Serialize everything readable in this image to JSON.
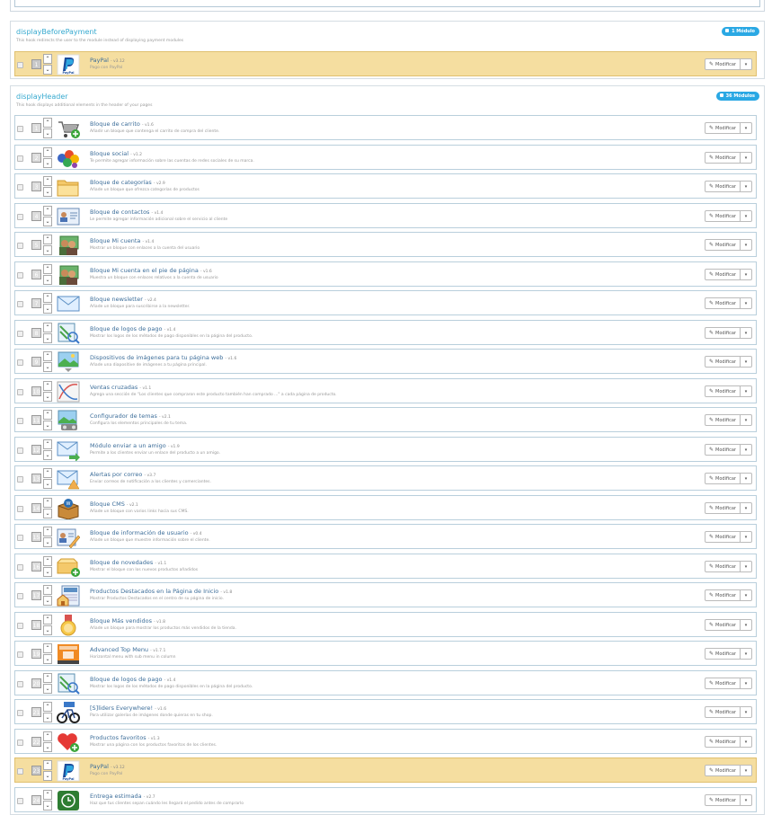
{
  "hooks": [
    {
      "name": "displayBeforePayment",
      "description": "This hook redirects the user to the module instead of displaying payment modules",
      "badge": "1 Módulo",
      "modules": [
        {
          "pos": "1",
          "name": "PayPal",
          "version": "- v3.12",
          "desc": "Pago con PayPal",
          "icon": "paypal-logo-icon",
          "highlight": true
        }
      ]
    },
    {
      "name": "displayHeader",
      "description": "This hook displays additional elements in the header of your pages",
      "badge": "36 Módulos",
      "modules": [
        {
          "pos": "1",
          "name": "Bloque de carrito",
          "version": "- v1.6",
          "desc": "Añadir un bloque que contenga el carrito de compra del cliente.",
          "icon": "shopping-cart-icon"
        },
        {
          "pos": "2",
          "name": "Bloque social",
          "version": "- v1.2",
          "desc": "Te permite agregar información sobre las cuentas de redes sociales de su marca.",
          "icon": "social-people-icon"
        },
        {
          "pos": "3",
          "name": "Bloque de categorías",
          "version": "- v2.9",
          "desc": "Añade un bloque que ofrezca categorías de productos",
          "icon": "folder-icon"
        },
        {
          "pos": "4",
          "name": "Bloque de contactos",
          "version": "- v1.4",
          "desc": "Le permite agregar información adicional sobre el servicio al cliente",
          "icon": "contact-card-icon"
        },
        {
          "pos": "5",
          "name": "Bloque Mi cuenta",
          "version": "- v1.4",
          "desc": "Mostrar un bloque con enlaces a la cuenta del usuario",
          "icon": "users-account-icon"
        },
        {
          "pos": "6",
          "name": "Bloque Mi cuenta en el pie de página",
          "version": "- v1.6",
          "desc": "Muestra un bloque con enlaces relativos a la cuenta de usuario",
          "icon": "users-account-icon"
        },
        {
          "pos": "7",
          "name": "Bloque newsletter",
          "version": "- v2.4",
          "desc": "Añade un bloque para suscribirse a la newsletter.",
          "icon": "envelope-icon"
        },
        {
          "pos": "8",
          "name": "Bloque de logos de pago",
          "version": "- v1.4",
          "desc": "Mostrar los logos de los métodos de pago disponibles en la página del producto.",
          "icon": "payment-logo-search-icon"
        },
        {
          "pos": "9",
          "name": "Dispositivos de imágenes para tu página web",
          "version": "- v1.6",
          "desc": "Añade una diapositive de imágenes a tu página principal.",
          "icon": "image-slider-icon"
        },
        {
          "pos": "10",
          "name": "Ventas cruzadas",
          "version": "- v1.1",
          "desc": "Agrega una sección de \"Los clientes que compraron este producto también han comprado ...\" a cada página de producto.",
          "icon": "cross-chart-icon"
        },
        {
          "pos": "11",
          "name": "Configurador de temas",
          "version": "- v2.1",
          "desc": "Configura los elementos principales de tu tema.",
          "icon": "theme-configurator-icon"
        },
        {
          "pos": "12",
          "name": "Módulo enviar a un amigo",
          "version": "- v1.9",
          "desc": "Permite a los clientes enviar un enlace del producto a un amigo.",
          "icon": "envelope-arrow-icon"
        },
        {
          "pos": "13",
          "name": "Alertas por correo",
          "version": "- v3.7",
          "desc": "Enviar correos de notificación a los clientes y comerciantes.",
          "icon": "envelope-warning-icon"
        },
        {
          "pos": "14",
          "name": "Bloque CMS",
          "version": "- v2.1",
          "desc": "Añade un bloque con varios links hacia sus CMS.",
          "icon": "cms-box-icon"
        },
        {
          "pos": "15",
          "name": "Bloque de información de usuario",
          "version": "- v0.4",
          "desc": "Añade un bloque que muestre información sobre el cliente.",
          "icon": "user-info-edit-icon"
        },
        {
          "pos": "16",
          "name": "Bloque de novedades",
          "version": "- v1.1",
          "desc": "Mostrar el bloque con los nuevos productos añadidos",
          "icon": "new-products-box-icon"
        },
        {
          "pos": "17",
          "name": "Productos Destacados en la Página de Inicio",
          "version": "- v1.8",
          "desc": "Mostrar Productos Destacados en el centro de su página de inicio.",
          "icon": "home-featured-icon"
        },
        {
          "pos": "18",
          "name": "Bloque Más vendidos",
          "version": "- v1.8",
          "desc": "Añade un bloque para mostrar los productos más vendidos de la tienda.",
          "icon": "medal-icon"
        },
        {
          "pos": "19",
          "name": "Advanced Top Menu",
          "version": "- v1.7.1",
          "desc": "Horizontal menu with sub menu in column",
          "icon": "top-menu-icon"
        },
        {
          "pos": "20",
          "name": "Bloque de logos de pago",
          "version": "- v1.4",
          "desc": "Mostrar los logos de los métodos de pago disponibles en la página del producto.",
          "icon": "payment-logo-search-icon"
        },
        {
          "pos": "21",
          "name": "[S]liders Everywhere!",
          "version": "- v1.6",
          "desc": "Para utilizar galerías de imágenes donde quieras en tu shop.",
          "icon": "sliders-bike-icon"
        },
        {
          "pos": "22",
          "name": "Productos favoritos",
          "version": "- v1.3",
          "desc": "Mostrar una página con los productos favoritos de los clientes.",
          "icon": "heart-plus-icon"
        },
        {
          "pos": "23",
          "name": "PayPal",
          "version": "- v3.12",
          "desc": "Pago con PayPal",
          "icon": "paypal-logo-icon",
          "highlight": true
        },
        {
          "pos": "24",
          "name": "Entrega estimada",
          "version": "- v2.7",
          "desc": "Haz que tus clientes sepan cuándo les llegará el pedido antes de comprarlo",
          "icon": "estimated-delivery-icon"
        }
      ]
    }
  ],
  "labels": {
    "modify": "Modificar",
    "up": "⌃",
    "down": "⌄",
    "dropdown": "▾",
    "pencil": "✎",
    "paypal_logo": "PayPal"
  }
}
